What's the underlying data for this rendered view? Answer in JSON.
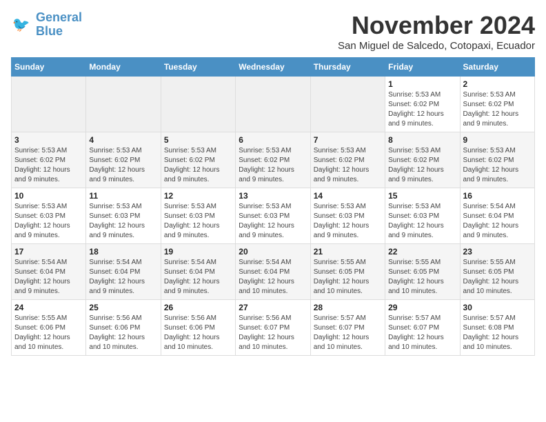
{
  "logo": {
    "line1": "General",
    "line2": "Blue"
  },
  "title": "November 2024",
  "location": "San Miguel de Salcedo, Cotopaxi, Ecuador",
  "days_of_week": [
    "Sunday",
    "Monday",
    "Tuesday",
    "Wednesday",
    "Thursday",
    "Friday",
    "Saturday"
  ],
  "weeks": [
    [
      {
        "num": "",
        "info": ""
      },
      {
        "num": "",
        "info": ""
      },
      {
        "num": "",
        "info": ""
      },
      {
        "num": "",
        "info": ""
      },
      {
        "num": "",
        "info": ""
      },
      {
        "num": "1",
        "info": "Sunrise: 5:53 AM\nSunset: 6:02 PM\nDaylight: 12 hours and 9 minutes."
      },
      {
        "num": "2",
        "info": "Sunrise: 5:53 AM\nSunset: 6:02 PM\nDaylight: 12 hours and 9 minutes."
      }
    ],
    [
      {
        "num": "3",
        "info": "Sunrise: 5:53 AM\nSunset: 6:02 PM\nDaylight: 12 hours and 9 minutes."
      },
      {
        "num": "4",
        "info": "Sunrise: 5:53 AM\nSunset: 6:02 PM\nDaylight: 12 hours and 9 minutes."
      },
      {
        "num": "5",
        "info": "Sunrise: 5:53 AM\nSunset: 6:02 PM\nDaylight: 12 hours and 9 minutes."
      },
      {
        "num": "6",
        "info": "Sunrise: 5:53 AM\nSunset: 6:02 PM\nDaylight: 12 hours and 9 minutes."
      },
      {
        "num": "7",
        "info": "Sunrise: 5:53 AM\nSunset: 6:02 PM\nDaylight: 12 hours and 9 minutes."
      },
      {
        "num": "8",
        "info": "Sunrise: 5:53 AM\nSunset: 6:02 PM\nDaylight: 12 hours and 9 minutes."
      },
      {
        "num": "9",
        "info": "Sunrise: 5:53 AM\nSunset: 6:02 PM\nDaylight: 12 hours and 9 minutes."
      }
    ],
    [
      {
        "num": "10",
        "info": "Sunrise: 5:53 AM\nSunset: 6:03 PM\nDaylight: 12 hours and 9 minutes."
      },
      {
        "num": "11",
        "info": "Sunrise: 5:53 AM\nSunset: 6:03 PM\nDaylight: 12 hours and 9 minutes."
      },
      {
        "num": "12",
        "info": "Sunrise: 5:53 AM\nSunset: 6:03 PM\nDaylight: 12 hours and 9 minutes."
      },
      {
        "num": "13",
        "info": "Sunrise: 5:53 AM\nSunset: 6:03 PM\nDaylight: 12 hours and 9 minutes."
      },
      {
        "num": "14",
        "info": "Sunrise: 5:53 AM\nSunset: 6:03 PM\nDaylight: 12 hours and 9 minutes."
      },
      {
        "num": "15",
        "info": "Sunrise: 5:53 AM\nSunset: 6:03 PM\nDaylight: 12 hours and 9 minutes."
      },
      {
        "num": "16",
        "info": "Sunrise: 5:54 AM\nSunset: 6:04 PM\nDaylight: 12 hours and 9 minutes."
      }
    ],
    [
      {
        "num": "17",
        "info": "Sunrise: 5:54 AM\nSunset: 6:04 PM\nDaylight: 12 hours and 9 minutes."
      },
      {
        "num": "18",
        "info": "Sunrise: 5:54 AM\nSunset: 6:04 PM\nDaylight: 12 hours and 9 minutes."
      },
      {
        "num": "19",
        "info": "Sunrise: 5:54 AM\nSunset: 6:04 PM\nDaylight: 12 hours and 9 minutes."
      },
      {
        "num": "20",
        "info": "Sunrise: 5:54 AM\nSunset: 6:04 PM\nDaylight: 12 hours and 10 minutes."
      },
      {
        "num": "21",
        "info": "Sunrise: 5:55 AM\nSunset: 6:05 PM\nDaylight: 12 hours and 10 minutes."
      },
      {
        "num": "22",
        "info": "Sunrise: 5:55 AM\nSunset: 6:05 PM\nDaylight: 12 hours and 10 minutes."
      },
      {
        "num": "23",
        "info": "Sunrise: 5:55 AM\nSunset: 6:05 PM\nDaylight: 12 hours and 10 minutes."
      }
    ],
    [
      {
        "num": "24",
        "info": "Sunrise: 5:55 AM\nSunset: 6:06 PM\nDaylight: 12 hours and 10 minutes."
      },
      {
        "num": "25",
        "info": "Sunrise: 5:56 AM\nSunset: 6:06 PM\nDaylight: 12 hours and 10 minutes."
      },
      {
        "num": "26",
        "info": "Sunrise: 5:56 AM\nSunset: 6:06 PM\nDaylight: 12 hours and 10 minutes."
      },
      {
        "num": "27",
        "info": "Sunrise: 5:56 AM\nSunset: 6:07 PM\nDaylight: 12 hours and 10 minutes."
      },
      {
        "num": "28",
        "info": "Sunrise: 5:57 AM\nSunset: 6:07 PM\nDaylight: 12 hours and 10 minutes."
      },
      {
        "num": "29",
        "info": "Sunrise: 5:57 AM\nSunset: 6:07 PM\nDaylight: 12 hours and 10 minutes."
      },
      {
        "num": "30",
        "info": "Sunrise: 5:57 AM\nSunset: 6:08 PM\nDaylight: 12 hours and 10 minutes."
      }
    ]
  ]
}
